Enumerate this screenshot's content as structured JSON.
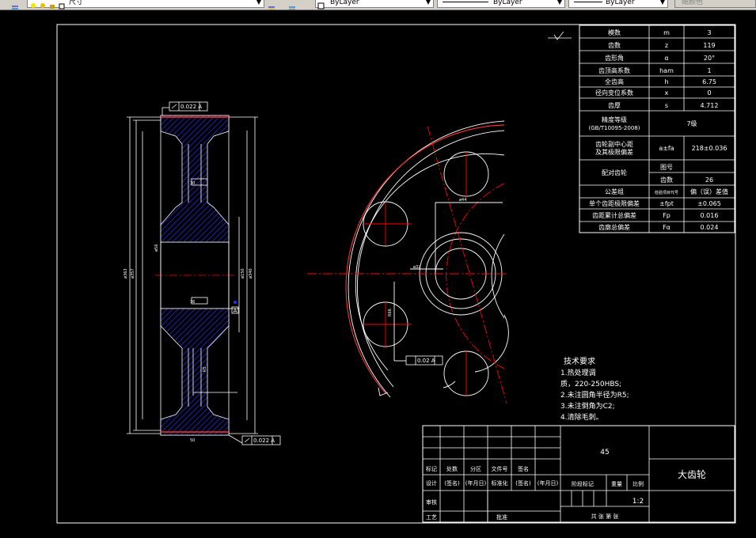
{
  "toolbar": {
    "layer_fragment": "尺寸",
    "color_combo": "ByLayer",
    "linetype_combo": "ByLayer",
    "lineweight_combo": "ByLayer",
    "plotstyle_combo": "随颜色"
  },
  "params_table": {
    "rows": [
      {
        "name": "模数",
        "symbol": "m",
        "value": "3"
      },
      {
        "name": "齿数",
        "symbol": "z",
        "value": "119"
      },
      {
        "name": "齿形角",
        "symbol": "α",
        "value": "20°"
      },
      {
        "name": "齿顶高系数",
        "symbol": "ham",
        "value": "1"
      },
      {
        "name": "全齿高",
        "symbol": "h",
        "value": "6.75"
      },
      {
        "name": "径向变位系数",
        "symbol": "x",
        "value": "0"
      },
      {
        "name": "齿厚",
        "symbol": "s",
        "value": "4.712"
      }
    ],
    "accuracy_label": "精度等级",
    "accuracy_std": "(GB/T10095-2008)",
    "accuracy_value": "7级",
    "center_label_1": "齿轮副中心距",
    "center_label_2": "及其极限偏差",
    "center_symbol": "a±fa",
    "center_value": "218±0.036",
    "mating_label": "配对齿轮",
    "mating_drawing_no": "图号",
    "mating_teeth_label": "齿数",
    "mating_teeth_value": "26",
    "group_label": "公差组",
    "group_symbol": "检验项目代号",
    "group_value": "偏（误）差值",
    "pitch_label": "单个齿距极限偏差",
    "pitch_symbol": "±fpt",
    "pitch_value": "±0.065",
    "cumulative_label": "齿距累计总偏差",
    "cumulative_symbol": "Fp",
    "cumulative_value": "0.016",
    "profile_label": "齿廓总偏差",
    "profile_symbol": "Fα",
    "profile_value": "0.024"
  },
  "tech_requirements": {
    "title": "技术要求",
    "lines": [
      "1.热处理调",
      "质，220-250HBS;",
      "2.未注圆角半径为R5;",
      "3.未注倒角为C2;",
      "4.清除毛刺。"
    ]
  },
  "title_block": {
    "material": "45",
    "part_name": "大齿轮",
    "scale": "1:2",
    "row_headers": [
      "标记",
      "处数",
      "分区",
      "文件号",
      "签名"
    ],
    "design_row": [
      "设计",
      "(签名)",
      "(年月日)",
      "标准化",
      "(签名)",
      "(年月日)"
    ],
    "stage_label": "阶段标记",
    "weight_label": "重量",
    "scale_label": "比例",
    "review_label": "审核",
    "process_label": "工艺",
    "approve_label": "批准",
    "sheets_label": "共 张 第 张"
  },
  "annotations": {
    "runout_top": "0.022 A",
    "runout_bottom": "0.022 A",
    "runout_mid": "0.02 A",
    "datum": "A"
  },
  "colors": {
    "background": "#000000",
    "lines": "#ffffff",
    "centerline": "#ff0000",
    "hatch": "#2d2df5",
    "toolbar": "#d4d0c8"
  }
}
